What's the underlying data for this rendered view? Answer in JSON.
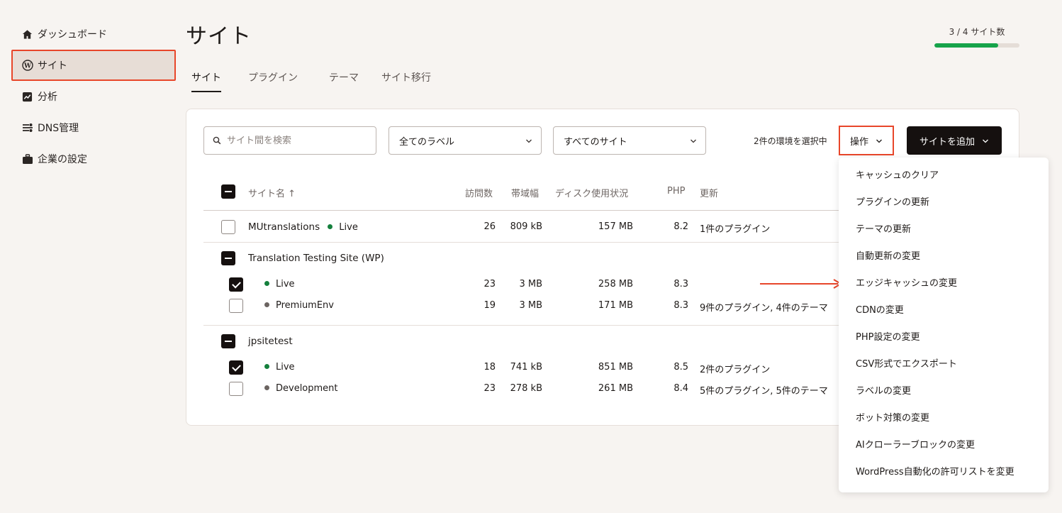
{
  "sidebar": {
    "items": [
      {
        "label": "ダッシュボード",
        "icon": "home-icon"
      },
      {
        "label": "サイト",
        "icon": "wordpress-icon"
      },
      {
        "label": "分析",
        "icon": "analytics-icon"
      },
      {
        "label": "DNS管理",
        "icon": "dns-icon"
      },
      {
        "label": "企業の設定",
        "icon": "briefcase-icon"
      }
    ],
    "active_index": 1
  },
  "header": {
    "title": "サイト",
    "quota_label": "3 / 4 サイト数",
    "quota_fraction": 0.75
  },
  "tabs": [
    {
      "label": "サイト"
    },
    {
      "label": "プラグイン"
    },
    {
      "label": "テーマ"
    },
    {
      "label": "サイト移行"
    }
  ],
  "toolbar": {
    "search_placeholder": "サイト間を検索",
    "labels_filter": "全てのラベル",
    "sites_filter": "すべてのサイト",
    "selection_text": "2件の環境を選択中",
    "operations_label": "操作",
    "add_site_label": "サイトを追加"
  },
  "table": {
    "columns": {
      "name": "サイト名 ↑",
      "visits": "訪問数",
      "bandwidth": "帯域幅",
      "disk": "ディスク使用状況",
      "php": "PHP",
      "updates": "更新"
    },
    "sites": [
      {
        "name": "MUtranslations",
        "single": true,
        "env": "Live",
        "visits": "26",
        "bandwidth": "809 kB",
        "disk": "157 MB",
        "php": "8.2",
        "updates": "1件のプラグイン"
      },
      {
        "name": "Translation Testing Site (WP)",
        "envs": [
          {
            "env": "Live",
            "status": "live",
            "checked": true,
            "visits": "23",
            "bandwidth": "3 MB",
            "disk": "258 MB",
            "php": "8.3",
            "updates": ""
          },
          {
            "env": "PremiumEnv",
            "status": "other",
            "checked": false,
            "visits": "19",
            "bandwidth": "3 MB",
            "disk": "171 MB",
            "php": "8.3",
            "updates": "9件のプラグイン, 4件のテーマ"
          }
        ]
      },
      {
        "name": "jpsitetest",
        "envs": [
          {
            "env": "Live",
            "status": "live",
            "checked": true,
            "visits": "18",
            "bandwidth": "741 kB",
            "disk": "851 MB",
            "php": "8.5",
            "updates": "2件のプラグイン"
          },
          {
            "env": "Development",
            "status": "other",
            "checked": false,
            "visits": "23",
            "bandwidth": "278 kB",
            "disk": "261 MB",
            "php": "8.4",
            "updates": "5件のプラグイン, 5件のテーマ"
          }
        ]
      }
    ]
  },
  "operations_menu": [
    "キャッシュのクリア",
    "プラグインの更新",
    "テーマの更新",
    "自動更新の変更",
    "エッジキャッシュの変更",
    "CDNの変更",
    "PHP設定の変更",
    "CSV形式でエクスポート",
    "ラベルの変更",
    "ボット対策の変更",
    "AIクローラーブロックの変更",
    "WordPress自動化の許可リストを変更"
  ],
  "colors": {
    "accent_highlight": "#e8462a",
    "live_dot": "#15803d",
    "quota_fill": "#16a34a",
    "primary_button": "#15100f"
  }
}
